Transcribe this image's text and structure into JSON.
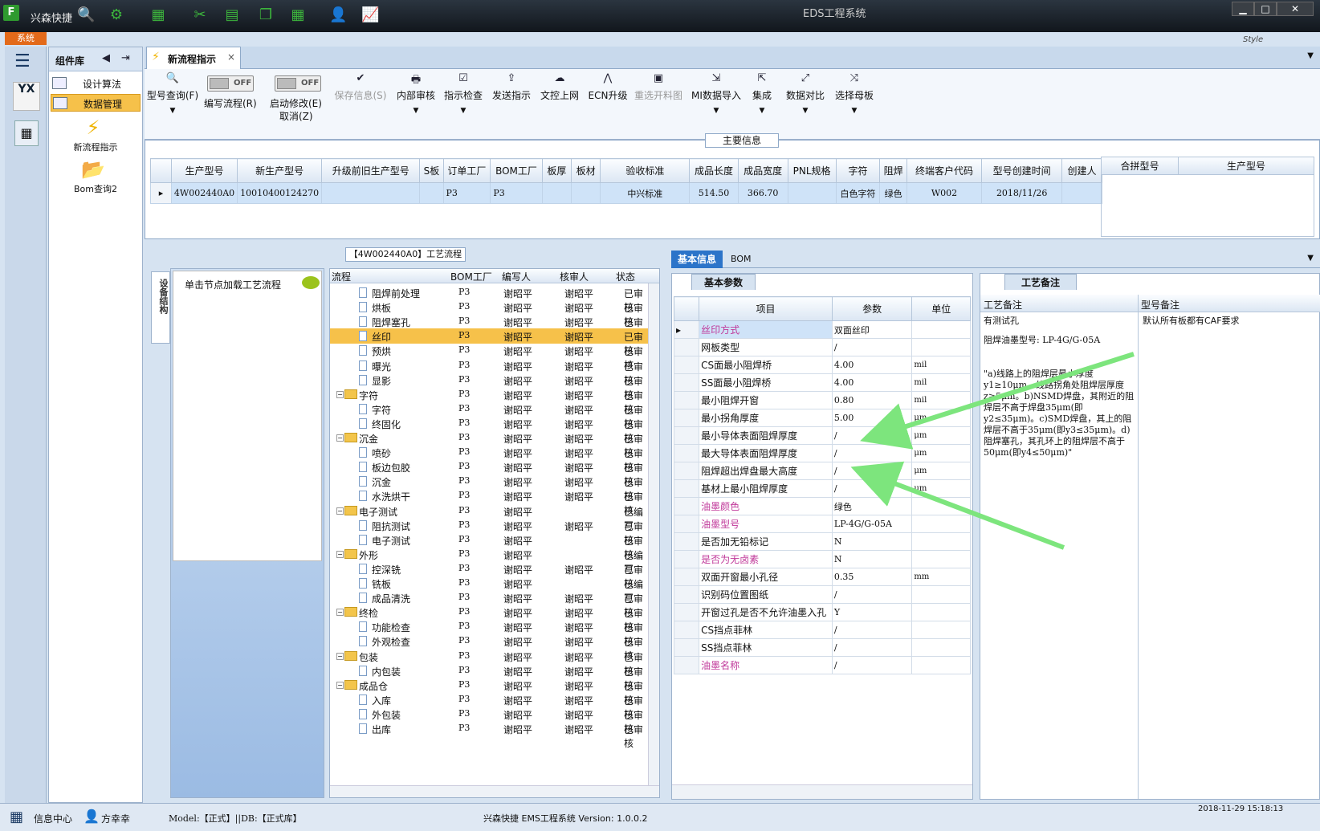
{
  "titlebar": {
    "app_name": "兴森快捷",
    "window_title": "EDS工程系统",
    "min": "▁",
    "max": "□",
    "close": "✕"
  },
  "sys_tab": "系统",
  "style_label": "Style",
  "rail": {
    "yx": "YX"
  },
  "complib": {
    "title": "组件库",
    "items": [
      {
        "label": "设计算法"
      },
      {
        "label": "数据管理"
      }
    ],
    "big_items": [
      {
        "label": "新流程指示"
      },
      {
        "label": "Bom查询2"
      }
    ]
  },
  "maintab": {
    "label": "新流程指示",
    "close": "×"
  },
  "toolbar": {
    "query": "型号查询(F)",
    "toggle_off": "OFF",
    "edit_flow": "编写流程(R)",
    "start_modify": "启动修改(E)",
    "cancel": "取消(Z)",
    "save": "保存信息(S)",
    "internal_review": "内部审核",
    "check": "指示检查",
    "send": "发送指示",
    "upload": "文控上网",
    "ecn": "ECN升级",
    "reselect": "重选开料图",
    "mi_import": "MI数据导入",
    "integrate": "集成",
    "compare": "数据对比",
    "select_board": "选择母板"
  },
  "main_info": {
    "title": "主要信息",
    "columns": [
      "生产型号",
      "新生产型号",
      "升级前旧生产型号",
      "S板",
      "订单工厂",
      "BOM工厂",
      "板厚",
      "板材",
      "验收标准",
      "成品长度",
      "成品宽度",
      "PNL规格",
      "字符",
      "阻焊",
      "终端客户代码",
      "型号创建时间",
      "创建人"
    ],
    "row": [
      "4W002440A0",
      "10010400124270",
      "",
      "",
      "P3",
      "P3",
      "",
      "",
      "中兴标准",
      "514.50",
      "366.70",
      "",
      "白色字符",
      "绿色",
      "W002",
      "2018/11/26",
      ""
    ],
    "merge_columns": [
      "合拼型号",
      "生产型号"
    ]
  },
  "process": {
    "title": "【4W002440A0】工艺流程",
    "vtab": "设备结构",
    "hint": "单击节点加载工艺流程",
    "columns": [
      "流程",
      "BOM工厂",
      "编写人",
      "核审人",
      "状态"
    ],
    "rows": [
      {
        "name": "阻焊前处理",
        "level": 2,
        "bom": "P3",
        "writer": "谢昭平",
        "reviewer": "谢昭平",
        "status": "已审核"
      },
      {
        "name": "烘板",
        "level": 2,
        "bom": "P3",
        "writer": "谢昭平",
        "reviewer": "谢昭平",
        "status": "已审核"
      },
      {
        "name": "阻焊塞孔",
        "level": 2,
        "bom": "P3",
        "writer": "谢昭平",
        "reviewer": "谢昭平",
        "status": "已审核"
      },
      {
        "name": "丝印",
        "level": 2,
        "bom": "P3",
        "writer": "谢昭平",
        "reviewer": "谢昭平",
        "status": "已审核",
        "selected": true
      },
      {
        "name": "预烘",
        "level": 2,
        "bom": "P3",
        "writer": "谢昭平",
        "reviewer": "谢昭平",
        "status": "已审核"
      },
      {
        "name": "曝光",
        "level": 2,
        "bom": "P3",
        "writer": "谢昭平",
        "reviewer": "谢昭平",
        "status": "已审核"
      },
      {
        "name": "显影",
        "level": 2,
        "bom": "P3",
        "writer": "谢昭平",
        "reviewer": "谢昭平",
        "status": "已审核"
      },
      {
        "name": "字符",
        "level": 1,
        "bom": "P3",
        "writer": "谢昭平",
        "reviewer": "谢昭平",
        "status": "已审核"
      },
      {
        "name": "字符",
        "level": 2,
        "bom": "P3",
        "writer": "谢昭平",
        "reviewer": "谢昭平",
        "status": "已审核"
      },
      {
        "name": "终固化",
        "level": 2,
        "bom": "P3",
        "writer": "谢昭平",
        "reviewer": "谢昭平",
        "status": "已审核"
      },
      {
        "name": "沉金",
        "level": 1,
        "bom": "P3",
        "writer": "谢昭平",
        "reviewer": "谢昭平",
        "status": "已审核"
      },
      {
        "name": "喷砂",
        "level": 2,
        "bom": "P3",
        "writer": "谢昭平",
        "reviewer": "谢昭平",
        "status": "已审核"
      },
      {
        "name": "板边包胶",
        "level": 2,
        "bom": "P3",
        "writer": "谢昭平",
        "reviewer": "谢昭平",
        "status": "已审核"
      },
      {
        "name": "沉金",
        "level": 2,
        "bom": "P3",
        "writer": "谢昭平",
        "reviewer": "谢昭平",
        "status": "已审核"
      },
      {
        "name": "水洗烘干",
        "level": 2,
        "bom": "P3",
        "writer": "谢昭平",
        "reviewer": "谢昭平",
        "status": "已审核"
      },
      {
        "name": "电子测试",
        "level": 1,
        "bom": "P3",
        "writer": "谢昭平",
        "reviewer": "",
        "status": "已编写"
      },
      {
        "name": "阻抗测试",
        "level": 2,
        "bom": "P3",
        "writer": "谢昭平",
        "reviewer": "谢昭平",
        "status": "已审核"
      },
      {
        "name": "电子测试",
        "level": 2,
        "bom": "P3",
        "writer": "谢昭平",
        "reviewer": "",
        "status": "已审核"
      },
      {
        "name": "外形",
        "level": 1,
        "bom": "P3",
        "writer": "谢昭平",
        "reviewer": "",
        "status": "已编写"
      },
      {
        "name": "控深铣",
        "level": 2,
        "bom": "P3",
        "writer": "谢昭平",
        "reviewer": "谢昭平",
        "status": "已审核"
      },
      {
        "name": "铣板",
        "level": 2,
        "bom": "P3",
        "writer": "谢昭平",
        "reviewer": "",
        "status": "已编写"
      },
      {
        "name": "成品清洗",
        "level": 2,
        "bom": "P3",
        "writer": "谢昭平",
        "reviewer": "谢昭平",
        "status": "已审核"
      },
      {
        "name": "终检",
        "level": 1,
        "bom": "P3",
        "writer": "谢昭平",
        "reviewer": "谢昭平",
        "status": "已审核"
      },
      {
        "name": "功能检查",
        "level": 2,
        "bom": "P3",
        "writer": "谢昭平",
        "reviewer": "谢昭平",
        "status": "已审核"
      },
      {
        "name": "外观检查",
        "level": 2,
        "bom": "P3",
        "writer": "谢昭平",
        "reviewer": "谢昭平",
        "status": "已审核"
      },
      {
        "name": "包装",
        "level": 1,
        "bom": "P3",
        "writer": "谢昭平",
        "reviewer": "谢昭平",
        "status": "已审核"
      },
      {
        "name": "内包装",
        "level": 2,
        "bom": "P3",
        "writer": "谢昭平",
        "reviewer": "谢昭平",
        "status": "已审核"
      },
      {
        "name": "成品仓",
        "level": 1,
        "bom": "P3",
        "writer": "谢昭平",
        "reviewer": "谢昭平",
        "status": "已审核"
      },
      {
        "name": "入库",
        "level": 2,
        "bom": "P3",
        "writer": "谢昭平",
        "reviewer": "谢昭平",
        "status": "已审核"
      },
      {
        "name": "外包装",
        "level": 2,
        "bom": "P3",
        "writer": "谢昭平",
        "reviewer": "谢昭平",
        "status": "已审核"
      },
      {
        "name": "出库",
        "level": 2,
        "bom": "P3",
        "writer": "谢昭平",
        "reviewer": "谢昭平",
        "status": "已审核"
      }
    ]
  },
  "right_tabs": {
    "basic": "基本信息",
    "bom": "BOM"
  },
  "params": {
    "caption": "基本参数",
    "columns": [
      "项目",
      "参数",
      "单位"
    ],
    "rows": [
      {
        "name": "丝印方式",
        "value": "双面丝印",
        "unit": "",
        "pink": true,
        "selected": true
      },
      {
        "name": "网板类型",
        "value": "/",
        "unit": ""
      },
      {
        "name": "CS面最小阻焊桥",
        "value": "4.00",
        "unit": "mil"
      },
      {
        "name": "SS面最小阻焊桥",
        "value": "4.00",
        "unit": "mil"
      },
      {
        "name": "最小阻焊开窗",
        "value": "0.80",
        "unit": "mil"
      },
      {
        "name": "最小拐角厚度",
        "value": "5.00",
        "unit": "μm"
      },
      {
        "name": "最小导体表面阻焊厚度",
        "value": "/",
        "unit": "μm"
      },
      {
        "name": "最大导体表面阻焊厚度",
        "value": "/",
        "unit": "μm"
      },
      {
        "name": "阻焊超出焊盘最大高度",
        "value": "/",
        "unit": "μm"
      },
      {
        "name": "基材上最小阻焊厚度",
        "value": "/",
        "unit": "μm"
      },
      {
        "name": "油墨颜色",
        "value": "绿色",
        "unit": "",
        "pink": true
      },
      {
        "name": "油墨型号",
        "value": "LP-4G/G-05A",
        "unit": "",
        "pink": true
      },
      {
        "name": "是否加无铅标记",
        "value": "N",
        "unit": ""
      },
      {
        "name": "是否为无卤素",
        "value": "N",
        "unit": "",
        "pink": true
      },
      {
        "name": "双面开窗最小孔径",
        "value": "0.35",
        "unit": "mm"
      },
      {
        "name": "识别码位置图纸",
        "value": "/",
        "unit": ""
      },
      {
        "name": "开窗过孔是否不允许油墨入孔",
        "value": "Y",
        "unit": ""
      },
      {
        "name": "CS挡点菲林",
        "value": "/",
        "unit": ""
      },
      {
        "name": "SS挡点菲林",
        "value": "/",
        "unit": ""
      },
      {
        "name": "油墨名称",
        "value": "/",
        "unit": "",
        "pink": true
      }
    ]
  },
  "notes": {
    "caption": "工艺备注",
    "col1": "工艺备注",
    "col2": "型号备注",
    "text1_a": "有测试孔",
    "text1_b": "阻焊油墨型号: LP-4G/G-05A",
    "text1_c": "\"a)线路上的阻焊层最小厚度y1≥10μm，线路拐角处阻焊层厚度z≥5μm。b)NSMD焊盘，其附近的阻焊层不高于焊盘35μm(即y2≤35μm)。c)SMD焊盘，其上的阻焊层不高于35μm(即y3≤35μm)。d)阻焊塞孔，其孔环上的阻焊层不高于50μm(即y4≤50μm)\"",
    "text2": "默认所有板都有CAF要求"
  },
  "status": {
    "info_center": "信息中心",
    "user": "方幸幸",
    "model": "Model:【正式】||DB:【正式库】",
    "version": "兴森快捷 EMS工程系统 Version: 1.0.0.2",
    "datetime": "2018-11-29 15:18:13"
  },
  "colors": {
    "accent": "#2c74c9",
    "selection": "#f6c14a",
    "arrow": "#7de57d",
    "pink": "#c0399a"
  }
}
